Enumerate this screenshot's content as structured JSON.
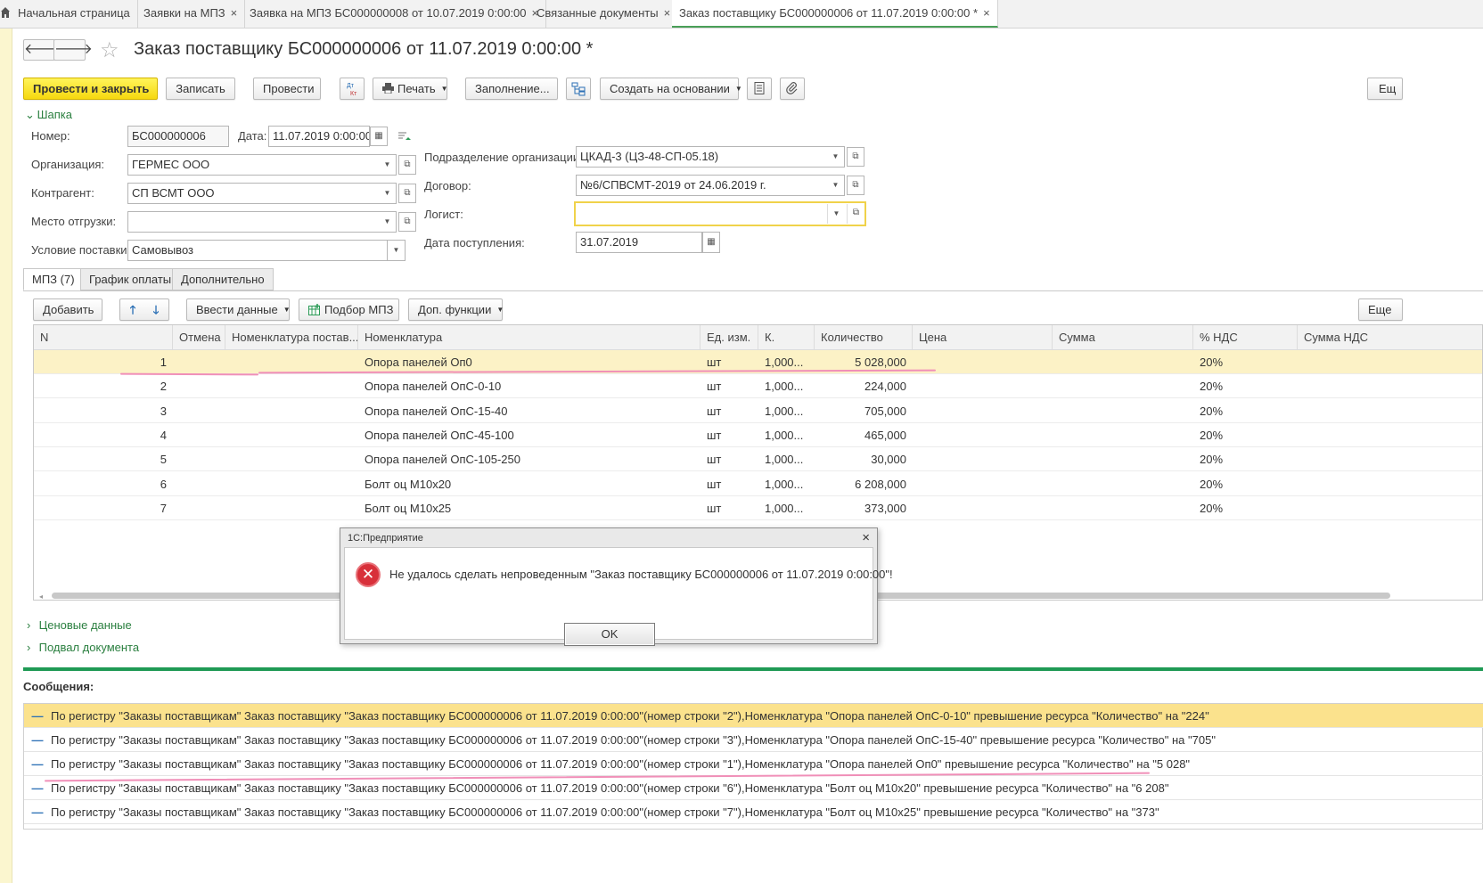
{
  "window_tabs": [
    {
      "label": "Начальная страница",
      "closable": false,
      "active": false
    },
    {
      "label": "Заявки на МПЗ",
      "closable": true,
      "active": false
    },
    {
      "label": "Заявка на МПЗ БС000000008 от 10.07.2019 0:00:00",
      "closable": true,
      "active": false
    },
    {
      "label": "Связанные документы",
      "closable": true,
      "active": false
    },
    {
      "label": "Заказ поставщику БС000000006 от 11.07.2019 0:00:00 *",
      "closable": true,
      "active": true
    }
  ],
  "tab_close_glyph": "×",
  "document": {
    "title": "Заказ поставщику БС000000006 от 11.07.2019 0:00:00 *"
  },
  "nav": {
    "back": "🡐",
    "forward": "🡒",
    "star": "☆"
  },
  "toolbar": {
    "post_and_close": "Провести и закрыть",
    "save": "Записать",
    "post": "Провести",
    "dt_kt": "Дт/Кт",
    "print": "Печать",
    "fill": "Заполнение...",
    "create_based_on": "Создать на основании",
    "more": "Ещ"
  },
  "header_section": {
    "label": "Шапка"
  },
  "fields": {
    "number_label": "Номер:",
    "number_value": "БС000000006",
    "date_label": "Дата:",
    "date_value": "11.07.2019  0:00:00",
    "org_label": "Организация:",
    "org_value": "ГЕРМЕС ООО",
    "counterparty_label": "Контрагент:",
    "counterparty_value": "СП ВСМТ ООО",
    "shipping_place_label": "Место отгрузки:",
    "shipping_place_value": "",
    "delivery_terms_label": "Условие поставки:",
    "delivery_terms_value": "Самовывоз",
    "subdivision_label": "Подразделение организации:",
    "subdivision_value": "ЦКАД-3 (ЦЗ-48-СП-05.18)",
    "contract_label": "Договор:",
    "contract_value": "№6/СПВСМТ-2019 от 24.06.2019 г.",
    "logist_label": "Логист:",
    "logist_value": "",
    "arrival_date_label": "Дата поступления:",
    "arrival_date_value": "31.07.2019"
  },
  "inner_tabs": [
    "МПЗ (7)",
    "График оплаты",
    "Дополнительно"
  ],
  "table_toolbar": {
    "add": "Добавить",
    "enter_data": "Ввести данные",
    "pick_mpz": "Подбор МПЗ",
    "extra_functions": "Доп. функции",
    "more": "Еще"
  },
  "table": {
    "columns": [
      "N",
      "Отмена",
      "Номенклатура постав...",
      "Номенклатура",
      "Ед. изм.",
      "К.",
      "Количество",
      "Цена",
      "Сумма",
      "% НДС",
      "Сумма НДС"
    ],
    "rows": [
      {
        "n": "1",
        "cancel": "",
        "supplier_item": "",
        "item": "Опора панелей Оп0",
        "unit": "шт",
        "k": "1,000...",
        "qty": "5 028,000",
        "price": "",
        "sum": "",
        "vat": "20%",
        "vat_sum": ""
      },
      {
        "n": "2",
        "cancel": "",
        "supplier_item": "",
        "item": "Опора панелей ОпС-0-10",
        "unit": "шт",
        "k": "1,000...",
        "qty": "224,000",
        "price": "",
        "sum": "",
        "vat": "20%",
        "vat_sum": ""
      },
      {
        "n": "3",
        "cancel": "",
        "supplier_item": "",
        "item": "Опора панелей ОпС-15-40",
        "unit": "шт",
        "k": "1,000...",
        "qty": "705,000",
        "price": "",
        "sum": "",
        "vat": "20%",
        "vat_sum": ""
      },
      {
        "n": "4",
        "cancel": "",
        "supplier_item": "",
        "item": "Опора панелей ОпС-45-100",
        "unit": "шт",
        "k": "1,000...",
        "qty": "465,000",
        "price": "",
        "sum": "",
        "vat": "20%",
        "vat_sum": ""
      },
      {
        "n": "5",
        "cancel": "",
        "supplier_item": "",
        "item": "Опора панелей ОпС-105-250",
        "unit": "шт",
        "k": "1,000...",
        "qty": "30,000",
        "price": "",
        "sum": "",
        "vat": "20%",
        "vat_sum": ""
      },
      {
        "n": "6",
        "cancel": "",
        "supplier_item": "",
        "item": "Болт оц М10х20",
        "unit": "шт",
        "k": "1,000...",
        "qty": "6 208,000",
        "price": "",
        "sum": "",
        "vat": "20%",
        "vat_sum": ""
      },
      {
        "n": "7",
        "cancel": "",
        "supplier_item": "",
        "item": "Болт оц М10х25",
        "unit": "шт",
        "k": "1,000...",
        "qty": "373,000",
        "price": "",
        "sum": "",
        "vat": "20%",
        "vat_sum": ""
      }
    ]
  },
  "collapsed_sections": [
    "Ценовые данные",
    "Подвал документа"
  ],
  "messages": {
    "title": "Сообщения:",
    "items": [
      "По регистру \"Заказы поставщикам\" Заказ поставщику \"Заказ поставщику БС000000006 от 11.07.2019 0:00:00\"(номер строки \"2\"),Номенклатура \"Опора панелей ОпС-0-10\" превышение ресурса \"Количество\" на \"224\"",
      "По регистру \"Заказы поставщикам\" Заказ поставщику \"Заказ поставщику БС000000006 от 11.07.2019 0:00:00\"(номер строки \"3\"),Номенклатура \"Опора панелей ОпС-15-40\" превышение ресурса \"Количество\" на \"705\"",
      "По регистру \"Заказы поставщикам\" Заказ поставщику \"Заказ поставщику БС000000006 от 11.07.2019 0:00:00\"(номер строки \"1\"),Номенклатура \"Опора панелей Оп0\" превышение ресурса \"Количество\" на \"5 028\"",
      "По регистру \"Заказы поставщикам\" Заказ поставщику \"Заказ поставщику БС000000006 от 11.07.2019 0:00:00\"(номер строки \"6\"),Номенклатура \"Болт оц М10х20\" превышение ресурса \"Количество\" на \"6 208\"",
      "По регистру \"Заказы поставщикам\" Заказ поставщику \"Заказ поставщику БС000000006 от 11.07.2019 0:00:00\"(номер строки \"7\"),Номенклатура \"Болт оц М10х25\" превышение ресурса \"Количество\" на \"373\""
    ]
  },
  "dialog": {
    "title": "1С:Предприятие",
    "message": "Не удалось сделать непроведенным \"Заказ поставщику БС000000006 от 11.07.2019 0:00:00\"!",
    "ok": "OK",
    "close": "×",
    "error_glyph": "✕"
  },
  "colors": {
    "accent_green": "#1f9a55",
    "primary_button": "#f6d80f",
    "selected_row": "#fcf2c6",
    "selected_message": "#fbe28d",
    "error_red": "#d8303a"
  }
}
